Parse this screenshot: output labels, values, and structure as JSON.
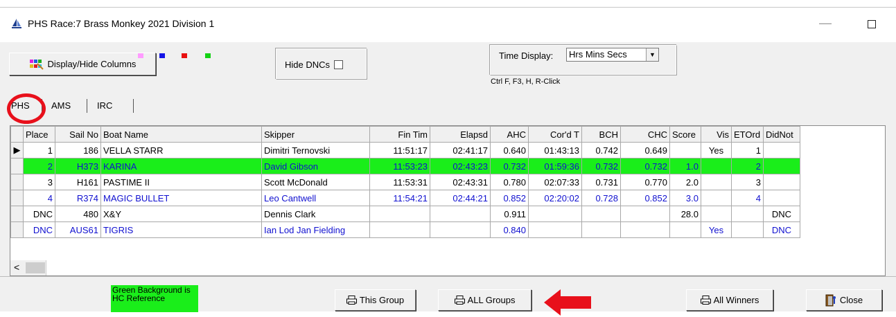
{
  "window": {
    "title": "PHS  Race:7  Brass Monkey 2021 Division 1"
  },
  "toolbar": {
    "display_hide_label": "Display/Hide Columns",
    "hide_dncs_label": "Hide DNCs",
    "time_display_label": "Time Display:",
    "time_display_value": "Hrs Mins Secs",
    "shortcut_hint": "Ctrl F, F3, H, R-Click",
    "swatch_colors": [
      "#ff9cff",
      "#1414e6",
      "#e81010",
      "#14d214"
    ]
  },
  "tabs": [
    {
      "label": "PHS",
      "active": true
    },
    {
      "label": "AMS"
    },
    {
      "label": "IRC"
    }
  ],
  "grid": {
    "columns": [
      "Place",
      "Sail No",
      "Boat Name",
      "Skipper",
      "Fin Tim",
      "Elapsd",
      "AHC",
      "Cor'd T",
      "BCH",
      "CHC",
      "Score",
      "Vis",
      "ETOrd",
      "DidNot"
    ],
    "rows": [
      {
        "style": "current",
        "cells": [
          "1",
          "186",
          "VELLA STARR",
          "Dimitri Ternovski",
          "11:51:17",
          "02:41:17",
          "0.640",
          "01:43:13",
          "0.742",
          "0.649",
          "",
          "Yes",
          "1",
          ""
        ]
      },
      {
        "style": "ref",
        "cells": [
          "2",
          "H373",
          "KARINA",
          "David Gibson",
          "11:53:23",
          "02:43:23",
          "0.732",
          "01:59:36",
          "0.732",
          "0.732",
          "1.0",
          "",
          "2",
          ""
        ]
      },
      {
        "style": "",
        "cells": [
          "3",
          "H161",
          "PASTIME II",
          "Scott McDonald",
          "11:53:31",
          "02:43:31",
          "0.780",
          "02:07:33",
          "0.731",
          "0.770",
          "2.0",
          "",
          "3",
          ""
        ]
      },
      {
        "style": "blue",
        "cells": [
          "4",
          "R374",
          "MAGIC BULLET",
          "Leo Cantwell",
          "11:54:21",
          "02:44:21",
          "0.852",
          "02:20:02",
          "0.728",
          "0.852",
          "3.0",
          "",
          "4",
          ""
        ]
      },
      {
        "style": "",
        "cells": [
          "DNC",
          "480",
          "X&Y",
          "Dennis Clark",
          "",
          "",
          "0.911",
          "",
          "",
          "",
          "28.0",
          "",
          "",
          "DNC"
        ]
      },
      {
        "style": "blue",
        "cells": [
          "DNC",
          "AUS61",
          "TIGRIS",
          "Ian Lod Jan Fielding",
          "",
          "",
          "0.840",
          "",
          "",
          "",
          "",
          "Yes",
          "",
          "DNC"
        ]
      }
    ]
  },
  "bottom": {
    "legend_text": "Green Background is HC Reference",
    "this_group_label": "This Group",
    "all_groups_label": "ALL Groups",
    "all_winners_label": "All Winners",
    "close_label": "Close"
  }
}
